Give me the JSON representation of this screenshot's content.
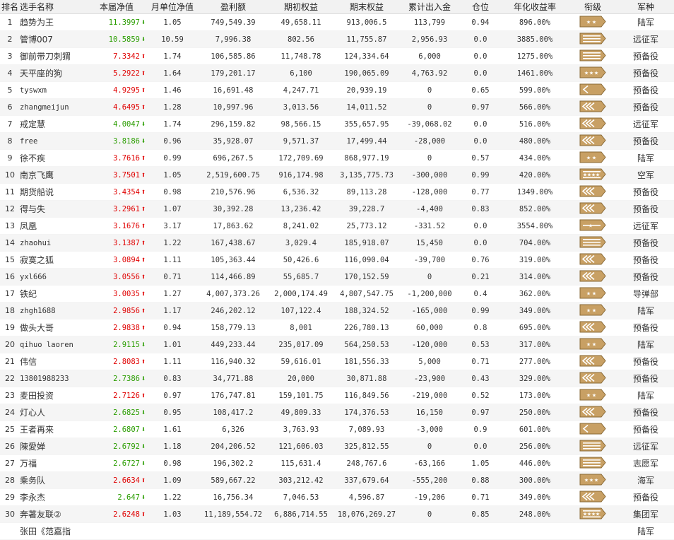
{
  "columns": [
    "排名",
    "选手名称",
    "本届净值",
    "月单位净值",
    "盈利额",
    "期初权益",
    "期末权益",
    "累计出入金",
    "仓位",
    "年化收益率",
    "衔级",
    "军种"
  ],
  "colors": {
    "up": "#e00000",
    "down": "#2a9d00",
    "badge": "#c8a064",
    "badge_border": "#8a6a36"
  },
  "rows": [
    {
      "rank": "1",
      "name": "趋势为王",
      "nav": "11.3997",
      "dir": "down",
      "monthly": "1.05",
      "profit": "749,549.39",
      "start": "49,658.11",
      "end": "913,006.5",
      "flow": "113,799",
      "position": "0.94",
      "annual": "896.00%",
      "insignia": "two-star-icon",
      "army": "陆军"
    },
    {
      "rank": "2",
      "name": "管博007",
      "nav": "10.5859",
      "dir": "down",
      "monthly": "10.59",
      "profit": "7,996.38",
      "start": "802.56",
      "end": "11,755.87",
      "flow": "2,956.93",
      "position": "0.0",
      "annual": "3885.00%",
      "insignia": "bars-three-icon",
      "army": "远征军"
    },
    {
      "rank": "3",
      "name": "御前带刀刺猬",
      "nav": "7.3342",
      "dir": "up",
      "monthly": "1.74",
      "profit": "106,585.86",
      "start": "11,748.78",
      "end": "124,334.64",
      "flow": "6,000",
      "position": "0.0",
      "annual": "1275.00%",
      "insignia": "bars-three-icon",
      "army": "预备役"
    },
    {
      "rank": "4",
      "name": "天平座的狗",
      "nav": "5.2922",
      "dir": "up",
      "monthly": "1.64",
      "profit": "179,201.17",
      "start": "6,100",
      "end": "190,065.09",
      "flow": "4,763.92",
      "position": "0.0",
      "annual": "1461.00%",
      "insignia": "three-star-icon",
      "army": "预备役"
    },
    {
      "rank": "5",
      "name": "tyswxm",
      "nav": "4.9295",
      "dir": "up",
      "monthly": "1.46",
      "profit": "16,691.48",
      "start": "4,247.71",
      "end": "20,939.19",
      "flow": "0",
      "position": "0.65",
      "annual": "599.00%",
      "insignia": "chevron-one-icon",
      "army": "预备役"
    },
    {
      "rank": "6",
      "name": "zhangmeijun",
      "nav": "4.6495",
      "dir": "up",
      "monthly": "1.28",
      "profit": "10,997.96",
      "start": "3,013.56",
      "end": "14,011.52",
      "flow": "0",
      "position": "0.97",
      "annual": "566.00%",
      "insignia": "chevron-three-icon",
      "army": "预备役"
    },
    {
      "rank": "7",
      "name": "戒定慧",
      "nav": "4.0047",
      "dir": "down",
      "monthly": "1.74",
      "profit": "296,159.82",
      "start": "98,566.15",
      "end": "355,657.95",
      "flow": "-39,068.02",
      "position": "0.0",
      "annual": "516.00%",
      "insignia": "chevron-three-icon",
      "army": "远征军"
    },
    {
      "rank": "8",
      "name": "free",
      "nav": "3.8186",
      "dir": "down",
      "monthly": "0.96",
      "profit": "35,928.07",
      "start": "9,571.37",
      "end": "17,499.44",
      "flow": "-28,000",
      "position": "0.0",
      "annual": "480.00%",
      "insignia": "chevron-three-icon",
      "army": "预备役"
    },
    {
      "rank": "9",
      "name": "徐不疾",
      "nav": "3.7616",
      "dir": "up",
      "monthly": "0.99",
      "profit": "696,267.5",
      "start": "172,709.69",
      "end": "868,977.19",
      "flow": "0",
      "position": "0.57",
      "annual": "434.00%",
      "insignia": "two-star-icon",
      "army": "陆军"
    },
    {
      "rank": "10",
      "name": "南京飞鹰",
      "nav": "3.7501",
      "dir": "up",
      "monthly": "1.05",
      "profit": "2,519,600.75",
      "start": "916,174.98",
      "end": "3,135,775.73",
      "flow": "-300,000",
      "position": "0.99",
      "annual": "420.00%",
      "insignia": "four-star-icon",
      "army": "空军"
    },
    {
      "rank": "11",
      "name": "期货船说",
      "nav": "3.4354",
      "dir": "up",
      "monthly": "0.98",
      "profit": "210,576.96",
      "start": "6,536.32",
      "end": "89,113.28",
      "flow": "-128,000",
      "position": "0.77",
      "annual": "1349.00%",
      "insignia": "chevron-three-icon",
      "army": "预备役"
    },
    {
      "rank": "12",
      "name": "得与失",
      "nav": "3.2961",
      "dir": "up",
      "monthly": "1.07",
      "profit": "30,392.28",
      "start": "13,236.42",
      "end": "39,228.7",
      "flow": "-4,400",
      "position": "0.83",
      "annual": "852.00%",
      "insignia": "chevron-three-icon",
      "army": "预备役"
    },
    {
      "rank": "13",
      "name": "凤凰",
      "nav": "3.1676",
      "dir": "up",
      "monthly": "3.17",
      "profit": "17,863.62",
      "start": "8,241.02",
      "end": "25,773.12",
      "flow": "-331.52",
      "position": "0.0",
      "annual": "3554.00%",
      "insignia": "one-star-icon",
      "army": "远征军"
    },
    {
      "rank": "14",
      "name": "zhaohui",
      "nav": "3.1387",
      "dir": "up",
      "monthly": "1.22",
      "profit": "167,438.67",
      "start": "3,029.4",
      "end": "185,918.07",
      "flow": "15,450",
      "position": "0.0",
      "annual": "704.00%",
      "insignia": "bars-three-icon",
      "army": "预备役"
    },
    {
      "rank": "15",
      "name": "寂寞之狐",
      "nav": "3.0894",
      "dir": "up",
      "monthly": "1.11",
      "profit": "105,363.44",
      "start": "50,426.6",
      "end": "116,090.04",
      "flow": "-39,700",
      "position": "0.76",
      "annual": "319.00%",
      "insignia": "chevron-three-icon",
      "army": "预备役"
    },
    {
      "rank": "16",
      "name": "yxl666",
      "nav": "3.0556",
      "dir": "up",
      "monthly": "0.71",
      "profit": "114,466.89",
      "start": "55,685.7",
      "end": "170,152.59",
      "flow": "0",
      "position": "0.21",
      "annual": "314.00%",
      "insignia": "chevron-three-icon",
      "army": "预备役"
    },
    {
      "rank": "17",
      "name": "铁纪",
      "nav": "3.0035",
      "dir": "up",
      "monthly": "1.27",
      "profit": "4,007,373.26",
      "start": "2,000,174.49",
      "end": "4,807,547.75",
      "flow": "-1,200,000",
      "position": "0.4",
      "annual": "362.00%",
      "insignia": "two-star-icon",
      "army": "导弹部"
    },
    {
      "rank": "18",
      "name": "zhgh1688",
      "nav": "2.9856",
      "dir": "up",
      "monthly": "1.17",
      "profit": "246,202.12",
      "start": "107,122.4",
      "end": "188,324.52",
      "flow": "-165,000",
      "position": "0.99",
      "annual": "349.00%",
      "insignia": "two-star-icon",
      "army": "陆军"
    },
    {
      "rank": "19",
      "name": "做头大哥",
      "nav": "2.9838",
      "dir": "up",
      "monthly": "0.94",
      "profit": "158,779.13",
      "start": "8,001",
      "end": "226,780.13",
      "flow": "60,000",
      "position": "0.8",
      "annual": "695.00%",
      "insignia": "chevron-three-icon",
      "army": "预备役"
    },
    {
      "rank": "20",
      "name": "qihuo laoren",
      "nav": "2.9115",
      "dir": "down",
      "monthly": "1.01",
      "profit": "449,233.44",
      "start": "235,017.09",
      "end": "564,250.53",
      "flow": "-120,000",
      "position": "0.53",
      "annual": "317.00%",
      "insignia": "two-star-icon",
      "army": "陆军"
    },
    {
      "rank": "21",
      "name": "伟信",
      "nav": "2.8083",
      "dir": "up",
      "monthly": "1.11",
      "profit": "116,940.32",
      "start": "59,616.01",
      "end": "181,556.33",
      "flow": "5,000",
      "position": "0.71",
      "annual": "277.00%",
      "insignia": "chevron-three-icon",
      "army": "预备役"
    },
    {
      "rank": "22",
      "name": "13801988233",
      "nav": "2.7386",
      "dir": "down",
      "monthly": "0.83",
      "profit": "34,771.88",
      "start": "20,000",
      "end": "30,871.88",
      "flow": "-23,900",
      "position": "0.43",
      "annual": "329.00%",
      "insignia": "chevron-three-icon",
      "army": "预备役"
    },
    {
      "rank": "23",
      "name": "麦田投资",
      "nav": "2.7126",
      "dir": "up",
      "monthly": "0.97",
      "profit": "176,747.81",
      "start": "159,101.75",
      "end": "116,849.56",
      "flow": "-219,000",
      "position": "0.52",
      "annual": "173.00%",
      "insignia": "two-star-icon",
      "army": "陆军"
    },
    {
      "rank": "24",
      "name": "灯心人",
      "nav": "2.6825",
      "dir": "down",
      "monthly": "0.95",
      "profit": "108,417.2",
      "start": "49,809.33",
      "end": "174,376.53",
      "flow": "16,150",
      "position": "0.97",
      "annual": "250.00%",
      "insignia": "chevron-three-icon",
      "army": "预备役"
    },
    {
      "rank": "25",
      "name": "王者再来",
      "nav": "2.6807",
      "dir": "down",
      "monthly": "1.61",
      "profit": "6,326",
      "start": "3,763.93",
      "end": "7,089.93",
      "flow": "-3,000",
      "position": "0.9",
      "annual": "601.00%",
      "insignia": "chevron-one-icon",
      "army": "预备役"
    },
    {
      "rank": "26",
      "name": "陳愛婵",
      "nav": "2.6792",
      "dir": "down",
      "monthly": "1.18",
      "profit": "204,206.52",
      "start": "121,606.03",
      "end": "325,812.55",
      "flow": "0",
      "position": "0.0",
      "annual": "256.00%",
      "insignia": "bars-three-icon",
      "army": "远征军"
    },
    {
      "rank": "27",
      "name": "万福",
      "nav": "2.6727",
      "dir": "down",
      "monthly": "0.98",
      "profit": "196,302.2",
      "start": "115,631.4",
      "end": "248,767.6",
      "flow": "-63,166",
      "position": "1.05",
      "annual": "446.00%",
      "insignia": "bars-three-icon",
      "army": "志愿军"
    },
    {
      "rank": "28",
      "name": "乘务队",
      "nav": "2.6634",
      "dir": "up",
      "monthly": "1.09",
      "profit": "589,667.22",
      "start": "303,212.42",
      "end": "337,679.64",
      "flow": "-555,200",
      "position": "0.88",
      "annual": "300.00%",
      "insignia": "three-star-icon",
      "army": "海军"
    },
    {
      "rank": "29",
      "name": "李永杰",
      "nav": "2.647",
      "dir": "down",
      "monthly": "1.22",
      "profit": "16,756.34",
      "start": "7,046.53",
      "end": "4,596.87",
      "flow": "-19,206",
      "position": "0.71",
      "annual": "349.00%",
      "insignia": "chevron-three-icon",
      "army": "预备役"
    },
    {
      "rank": "30",
      "name": "奔著友联②",
      "nav": "2.6248",
      "dir": "up",
      "monthly": "1.03",
      "profit": "11,189,554.72",
      "start": "6,886,714.55",
      "end": "18,076,269.27",
      "flow": "0",
      "position": "0.85",
      "annual": "248.00%",
      "insignia": "four-star-icon",
      "army": "集团军"
    },
    {
      "rank": "",
      "name": "张田《范嘉指",
      "nav": "",
      "dir": "",
      "monthly": "",
      "profit": "",
      "start": "",
      "end": "",
      "flow": "",
      "position": "",
      "annual": "",
      "insignia": "",
      "army": "陆军"
    }
  ]
}
